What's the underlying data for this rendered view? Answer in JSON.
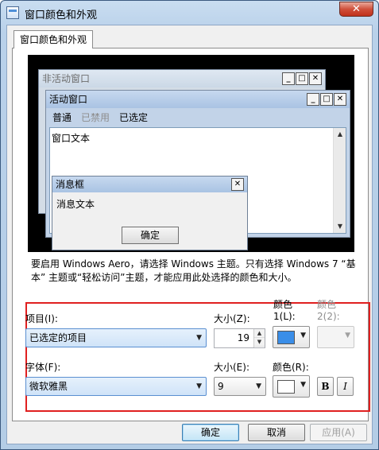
{
  "window": {
    "title": "窗口颜色和外观",
    "close_label": "✕"
  },
  "tab": {
    "label": "窗口颜色和外观"
  },
  "preview": {
    "inactive_title": "非活动窗口",
    "active_title": "活动窗口",
    "menu": {
      "normal": "普通",
      "disabled": "已禁用",
      "selected": "已选定"
    },
    "window_text": "窗口文本",
    "msgbox_title": "消息框",
    "msgbox_text": "消息文本",
    "msgbox_ok": "确定",
    "ctrl_min": "_",
    "ctrl_max": "□",
    "ctrl_close": "✕"
  },
  "description": "要启用 Windows Aero，请选择 Windows 主题。只有选择 Windows 7 “基本” 主题或“轻松访问”主题，才能应用此处选择的颜色和大小。",
  "settings": {
    "item_label": "项目(I):",
    "item_value": "已选定的项目",
    "size1_label": "大小(Z):",
    "size1_value": "19",
    "color1_label_line1": "颜色",
    "color1_label_line2": "1(L):",
    "color1_value": "#3a8ee8",
    "color2_label_line1": "颜色",
    "color2_label_line2": "2(2):",
    "font_label": "字体(F):",
    "font_value": "微软雅黑",
    "size2_label": "大小(E):",
    "size2_value": "9",
    "fontcolor_label": "颜色(R):",
    "fontcolor_value": "#ffffff",
    "bold_label": "B",
    "italic_label": "I"
  },
  "buttons": {
    "ok": "确定",
    "cancel": "取消",
    "apply": "应用(A)"
  }
}
